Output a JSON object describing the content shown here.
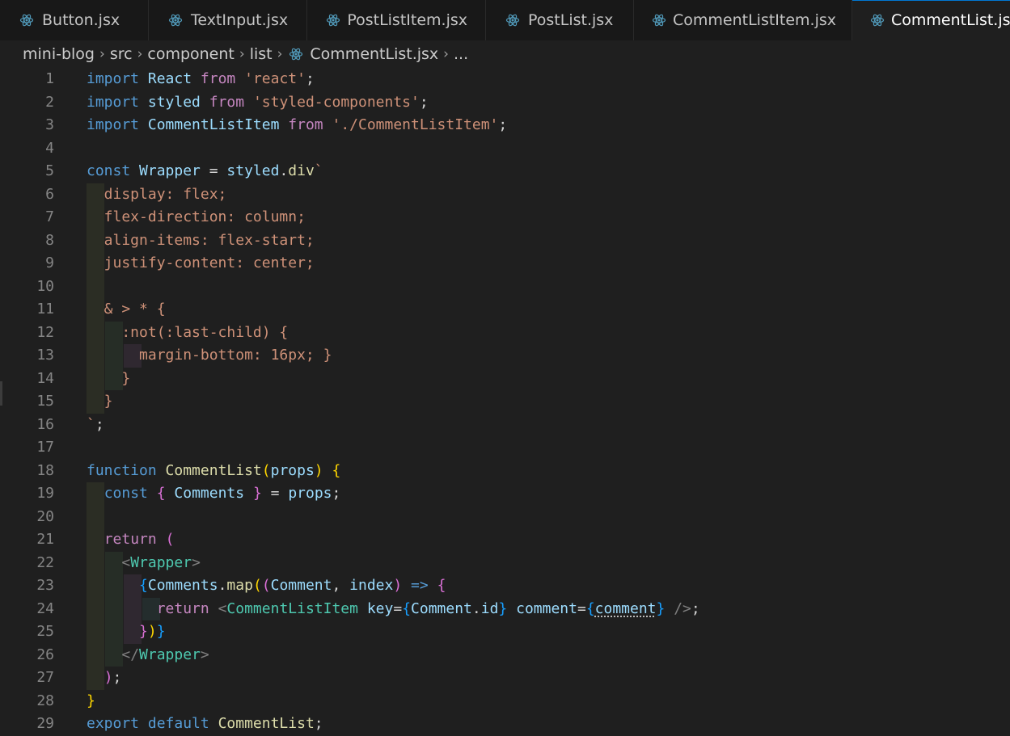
{
  "tabs": [
    {
      "label": "Button.jsx",
      "active": false
    },
    {
      "label": "TextInput.jsx",
      "active": false
    },
    {
      "label": "PostListItem.jsx",
      "active": false
    },
    {
      "label": "PostList.jsx",
      "active": false
    },
    {
      "label": "CommentListItem.jsx",
      "active": false
    },
    {
      "label": "CommentList.jsx",
      "active": true
    }
  ],
  "breadcrumb": {
    "items": [
      "mini-blog",
      "src",
      "component",
      "list"
    ],
    "file": "CommentList.jsx",
    "more": "..."
  },
  "icons": {
    "file_icon": "react-icon",
    "separator": "chevron-right-icon"
  },
  "colors": {
    "accent": "#0078d4",
    "keyword": "#569cd6",
    "control": "#c586c0",
    "variable": "#9cdcfe",
    "type": "#4ec9b0",
    "string": "#ce9178",
    "function": "#dcdcaa"
  },
  "editor": {
    "lines": [
      [
        [
          "kw",
          "import"
        ],
        [
          "punc",
          " "
        ],
        [
          "id",
          "React"
        ],
        [
          "punc",
          " "
        ],
        [
          "ctl",
          "from"
        ],
        [
          "punc",
          " "
        ],
        [
          "str",
          "'react'"
        ],
        [
          "punc",
          ";"
        ]
      ],
      [
        [
          "kw",
          "import"
        ],
        [
          "punc",
          " "
        ],
        [
          "id",
          "styled"
        ],
        [
          "punc",
          " "
        ],
        [
          "ctl",
          "from"
        ],
        [
          "punc",
          " "
        ],
        [
          "str",
          "'styled-components'"
        ],
        [
          "punc",
          ";"
        ]
      ],
      [
        [
          "kw",
          "import"
        ],
        [
          "punc",
          " "
        ],
        [
          "id",
          "CommentListItem"
        ],
        [
          "punc",
          " "
        ],
        [
          "ctl",
          "from"
        ],
        [
          "punc",
          " "
        ],
        [
          "str",
          "'./CommentListItem'"
        ],
        [
          "punc",
          ";"
        ]
      ],
      [],
      [
        [
          "kw",
          "const"
        ],
        [
          "punc",
          " "
        ],
        [
          "id",
          "Wrapper"
        ],
        [
          "punc",
          " = "
        ],
        [
          "id",
          "styled"
        ],
        [
          "punc",
          "."
        ],
        [
          "fn",
          "div"
        ],
        [
          "str",
          "`"
        ]
      ],
      [
        [
          "css",
          "  display: flex;"
        ]
      ],
      [
        [
          "css",
          "  flex-direction: column;"
        ]
      ],
      [
        [
          "css",
          "  align-items: flex-start;"
        ]
      ],
      [
        [
          "css",
          "  justify-content: center;"
        ]
      ],
      [],
      [
        [
          "css",
          "  & > * {"
        ]
      ],
      [
        [
          "css",
          "    :not(:last-child) {"
        ]
      ],
      [
        [
          "css",
          "      margin-bottom: 16px; }"
        ]
      ],
      [
        [
          "css",
          "    }"
        ]
      ],
      [
        [
          "css",
          "  }"
        ]
      ],
      [
        [
          "str",
          "`"
        ],
        [
          "punc",
          ";"
        ]
      ],
      [],
      [
        [
          "kw",
          "function"
        ],
        [
          "punc",
          " "
        ],
        [
          "fn",
          "CommentList"
        ],
        [
          "p1",
          "("
        ],
        [
          "id",
          "props"
        ],
        [
          "p1",
          ")"
        ],
        [
          "punc",
          " "
        ],
        [
          "p1",
          "{"
        ]
      ],
      [
        [
          "punc",
          "  "
        ],
        [
          "kw",
          "const"
        ],
        [
          "punc",
          " "
        ],
        [
          "p2",
          "{"
        ],
        [
          "punc",
          " "
        ],
        [
          "id",
          "Comments"
        ],
        [
          "punc",
          " "
        ],
        [
          "p2",
          "}"
        ],
        [
          "punc",
          " = "
        ],
        [
          "id",
          "props"
        ],
        [
          "punc",
          ";"
        ]
      ],
      [],
      [
        [
          "punc",
          "  "
        ],
        [
          "ctl",
          "return"
        ],
        [
          "punc",
          " "
        ],
        [
          "p2",
          "("
        ]
      ],
      [
        [
          "punc",
          "    "
        ],
        [
          "tagb",
          "<"
        ],
        [
          "tag",
          "Wrapper"
        ],
        [
          "tagb",
          ">"
        ]
      ],
      [
        [
          "punc",
          "      "
        ],
        [
          "p3",
          "{"
        ],
        [
          "id",
          "Comments"
        ],
        [
          "punc",
          "."
        ],
        [
          "fn",
          "map"
        ],
        [
          "p1",
          "("
        ],
        [
          "p2",
          "("
        ],
        [
          "id",
          "Comment"
        ],
        [
          "punc",
          ", "
        ],
        [
          "id",
          "index"
        ],
        [
          "p2",
          ")"
        ],
        [
          "punc",
          " "
        ],
        [
          "kw",
          "=>"
        ],
        [
          "punc",
          " "
        ],
        [
          "p2",
          "{"
        ]
      ],
      [
        [
          "punc",
          "        "
        ],
        [
          "ctl",
          "return"
        ],
        [
          "punc",
          " "
        ],
        [
          "tagb",
          "<"
        ],
        [
          "tag",
          "CommentListItem"
        ],
        [
          "punc",
          " "
        ],
        [
          "attr",
          "key"
        ],
        [
          "punc",
          "="
        ],
        [
          "p3",
          "{"
        ],
        [
          "id",
          "Comment"
        ],
        [
          "punc",
          "."
        ],
        [
          "id",
          "id"
        ],
        [
          "p3",
          "}"
        ],
        [
          "punc",
          " "
        ],
        [
          "attr",
          "comment"
        ],
        [
          "punc",
          "="
        ],
        [
          "p3",
          "{"
        ],
        [
          "id sq",
          "comment"
        ],
        [
          "p3",
          "}"
        ],
        [
          "punc",
          " "
        ],
        [
          "tagb",
          "/>"
        ],
        [
          "punc",
          ";"
        ]
      ],
      [
        [
          "punc",
          "      "
        ],
        [
          "p2",
          "}"
        ],
        [
          "p1",
          ")"
        ],
        [
          "p3",
          "}"
        ]
      ],
      [
        [
          "punc",
          "    "
        ],
        [
          "tagb",
          "</"
        ],
        [
          "tag",
          "Wrapper"
        ],
        [
          "tagb",
          ">"
        ]
      ],
      [
        [
          "punc",
          "  "
        ],
        [
          "p2",
          ")"
        ],
        [
          "punc",
          ";"
        ]
      ],
      [
        [
          "p1",
          "}"
        ]
      ],
      [
        [
          "kw",
          "export"
        ],
        [
          "punc",
          " "
        ],
        [
          "kw",
          "default"
        ],
        [
          "punc",
          " "
        ],
        [
          "fn",
          "CommentList"
        ],
        [
          "punc",
          ";"
        ]
      ]
    ]
  }
}
